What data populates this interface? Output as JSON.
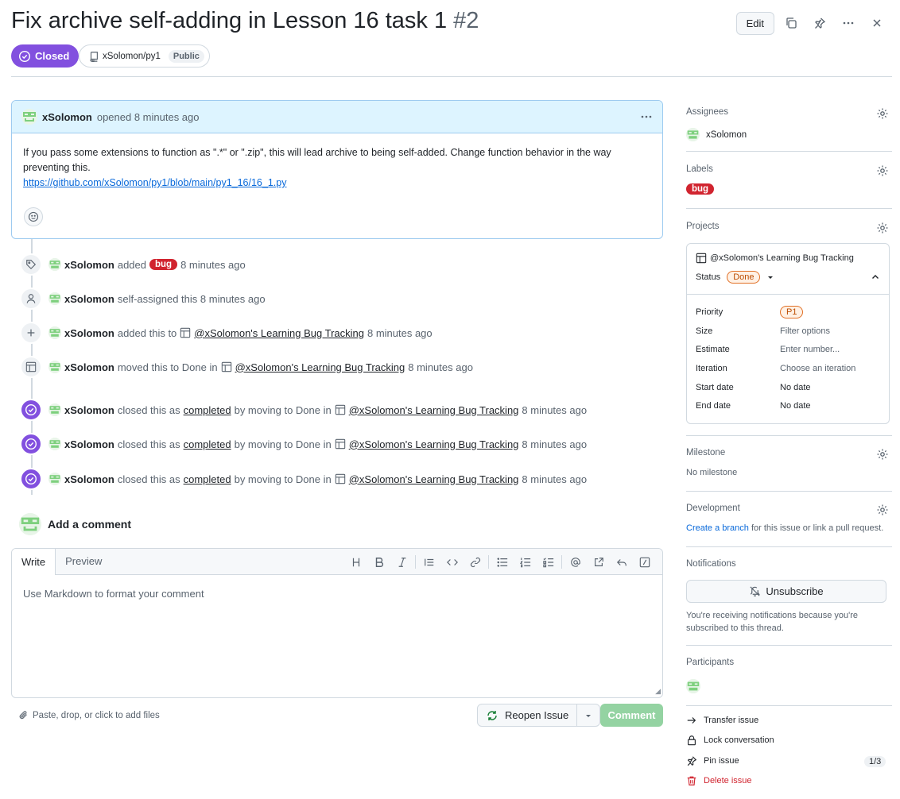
{
  "issue": {
    "title": "Fix archive self-adding in Lesson 16 task 1",
    "number": "#2",
    "state": "Closed",
    "repo": "xSolomon/py1",
    "visibility": "Public"
  },
  "header_actions": {
    "edit_label": "Edit"
  },
  "comment": {
    "author": "xSolomon",
    "meta": "opened 8 minutes ago",
    "body_line1": "If you pass some extensions to function as \".*\" or \".zip\", this will lead archive to being self-added. Change function behavior in the way",
    "body_line2": "preventing this.",
    "link": "https://github.com/xSolomon/py1/blob/main/py1_16/16_1.py"
  },
  "timeline": [
    {
      "icon": "tag-icon",
      "who": "xSolomon",
      "text": "added",
      "label": "bug",
      "time": "8 minutes ago"
    },
    {
      "icon": "person-icon",
      "who": "xSolomon",
      "text": "self-assigned this 8 minutes ago"
    },
    {
      "icon": "plus-icon",
      "who": "xSolomon",
      "text": "added this to",
      "project": "@xSolomon's Learning Bug Tracking",
      "time": "8 minutes ago"
    },
    {
      "icon": "table-icon",
      "who": "xSolomon",
      "text": "moved this to Done in",
      "project": "@xSolomon's Learning Bug Tracking",
      "time": "8 minutes ago"
    },
    {
      "icon": "check-circle-icon",
      "who": "xSolomon",
      "text": "closed this as",
      "completed": "completed",
      "mid": "by moving to Done in",
      "project": "@xSolomon's Learning Bug Tracking",
      "time": "8 minutes ago"
    },
    {
      "icon": "check-circle-icon",
      "who": "xSolomon",
      "text": "closed this as",
      "completed": "completed",
      "mid": "by moving to Done in",
      "project": "@xSolomon's Learning Bug Tracking",
      "time": "8 minutes ago"
    },
    {
      "icon": "check-circle-icon",
      "who": "xSolomon",
      "text": "closed this as",
      "completed": "completed",
      "mid": "by moving to Done in",
      "project": "@xSolomon's Learning Bug Tracking",
      "time": "8 minutes ago"
    }
  ],
  "add_comment": {
    "heading": "Add a comment",
    "tab_write": "Write",
    "tab_preview": "Preview",
    "placeholder": "Use Markdown to format your comment",
    "attach": "Paste, drop, or click to add files",
    "reopen": "Reopen Issue",
    "submit": "Comment"
  },
  "sidebar": {
    "assignees": {
      "title": "Assignees",
      "value": "xSolomon"
    },
    "labels": {
      "title": "Labels",
      "value": "bug"
    },
    "projects": {
      "title": "Projects",
      "name": "@xSolomon's Learning Bug Tracking",
      "status_label": "Status",
      "status_value": "Done",
      "fields": [
        {
          "key": "Priority",
          "value": "P1"
        },
        {
          "key": "Size",
          "value": "Filter options"
        },
        {
          "key": "Estimate",
          "value": "Enter number..."
        },
        {
          "key": "Iteration",
          "value": "Choose an iteration"
        },
        {
          "key": "Start date",
          "value": "No date"
        },
        {
          "key": "End date",
          "value": "No date"
        }
      ]
    },
    "milestone": {
      "title": "Milestone",
      "value": "No milestone"
    },
    "development": {
      "title": "Development",
      "link": "Create a branch",
      "rest": " for this issue or link a pull request."
    },
    "notifications": {
      "title": "Notifications",
      "button": "Unsubscribe",
      "note": "You're receiving notifications because you're subscribed to this thread."
    },
    "participants": {
      "title": "Participants"
    },
    "actions": {
      "transfer": "Transfer issue",
      "lock": "Lock conversation",
      "pin": "Pin issue",
      "pin_count": "1/3",
      "delete": "Delete issue"
    }
  },
  "colors": {
    "closed": "#8250df",
    "bug": "#d1242f",
    "link": "#0969da",
    "comment_btn": "#94d3a2"
  }
}
